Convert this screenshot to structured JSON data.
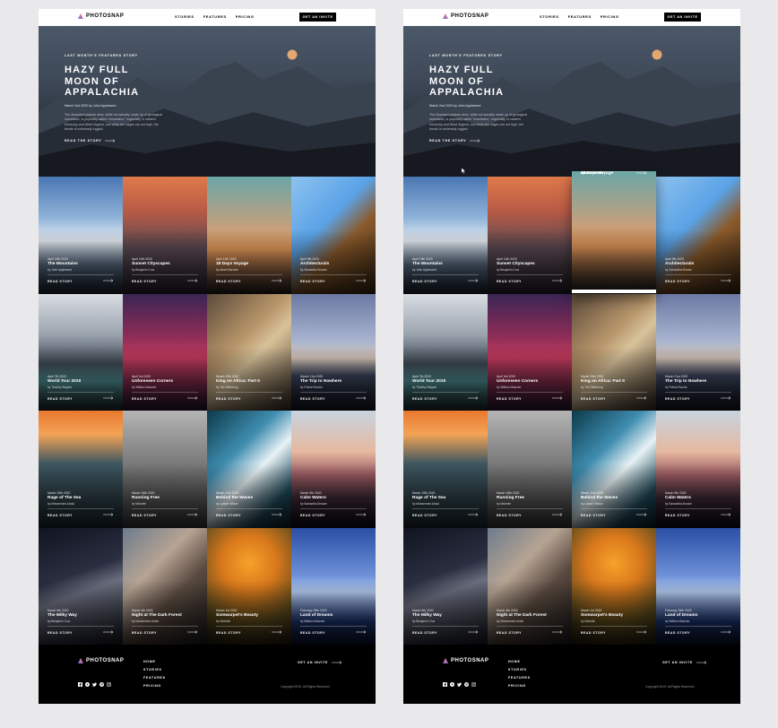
{
  "brand": {
    "name": "PHOTOSNAP"
  },
  "nav": {
    "links": [
      "STORIES",
      "FEATURES",
      "PRICING"
    ],
    "invite": "GET AN INVITE"
  },
  "hero": {
    "eyebrow": "LAST MONTH'S FEATURED STORY",
    "title_lines": [
      "HAZY FULL",
      "MOON OF",
      "APPALACHIA"
    ],
    "date": "March 2nd 2020",
    "author_prefix": "by",
    "author": "John Appleseed",
    "description": "The dissected plateau area, while not actually made up of geological mountains, is popularly called \"mountains,\" especially in eastern Kentucky and West Virginia, and while the ridges are not high, the terrain is extremely rugged.",
    "cta": "READ THE STORY"
  },
  "stories": [
    {
      "date": "April 16th 2020",
      "title": "The Mountains",
      "author": "by John Appleseed",
      "read": "READ STORY"
    },
    {
      "date": "April 14th 2020",
      "title": "Sunset Cityscapes",
      "author": "by Benjamin Cruz",
      "read": "READ STORY"
    },
    {
      "date": "April 11th 2020",
      "title": "18 Days Voyage",
      "author": "by Alexei Borodin",
      "read": "READ STORY"
    },
    {
      "date": "April 9th 2020",
      "title": "Architecturals",
      "author": "by Samantha Brooke",
      "read": "READ STORY"
    },
    {
      "date": "April 7th 2020",
      "title": "World Tour 2019",
      "author": "by Timothy Wagner",
      "read": "READ STORY"
    },
    {
      "date": "April 3rd 2020",
      "title": "Unforeseen Corners",
      "author": "by William Malcolm",
      "read": "READ STORY"
    },
    {
      "date": "March 29th 2020",
      "title": "King on Africa: Part II",
      "author": "by Tim Hillenburg",
      "read": "READ STORY"
    },
    {
      "date": "March 21st 2020",
      "title": "The Trip to Nowhere",
      "author": "by Felicia Rourke",
      "read": "READ STORY"
    },
    {
      "date": "March 19th 2020",
      "title": "Rage of The Sea",
      "author": "by Mohammed Abdul",
      "read": "READ STORY"
    },
    {
      "date": "March 16th 2020",
      "title": "Running Free",
      "author": "by Michelle",
      "read": "READ STORY"
    },
    {
      "date": "March 11th 2020",
      "title": "Behind the Waves",
      "author": "by Lamarr Wilson",
      "read": "READ STORY"
    },
    {
      "date": "March 9th 2020",
      "title": "Calm Waters",
      "author": "by Samantha Brooke",
      "read": "READ STORY"
    },
    {
      "date": "March 5th 2020",
      "title": "The Milky Way",
      "author": "by Benjamin Cruz",
      "read": "READ STORY"
    },
    {
      "date": "March 4th 2020",
      "title": "Night at The Dark Forest",
      "author": "by Mohammed Abdul",
      "read": "READ STORY"
    },
    {
      "date": "March 1st 2020",
      "title": "Somwarpet's Beauty",
      "author": "by Michelle",
      "read": "READ STORY"
    },
    {
      "date": "February 25th 2020",
      "title": "Land of Dreams",
      "author": "by William Malcolm",
      "read": "READ STORY"
    }
  ],
  "footer": {
    "links": [
      "HOME",
      "STORIES",
      "FEATURES",
      "PRICING"
    ],
    "cta": "GET AN INVITE",
    "copyright": "Copyright 2019. All Rights Reserved",
    "social_icons": [
      "facebook-icon",
      "youtube-icon",
      "twitter-icon",
      "pinterest-icon",
      "instagram-icon"
    ]
  },
  "colors": {
    "accent_gradient": [
      "#FFC593",
      "#BC7198",
      "#5A77FF"
    ],
    "background": "#000000",
    "page_bg": "#E9E9EC"
  }
}
